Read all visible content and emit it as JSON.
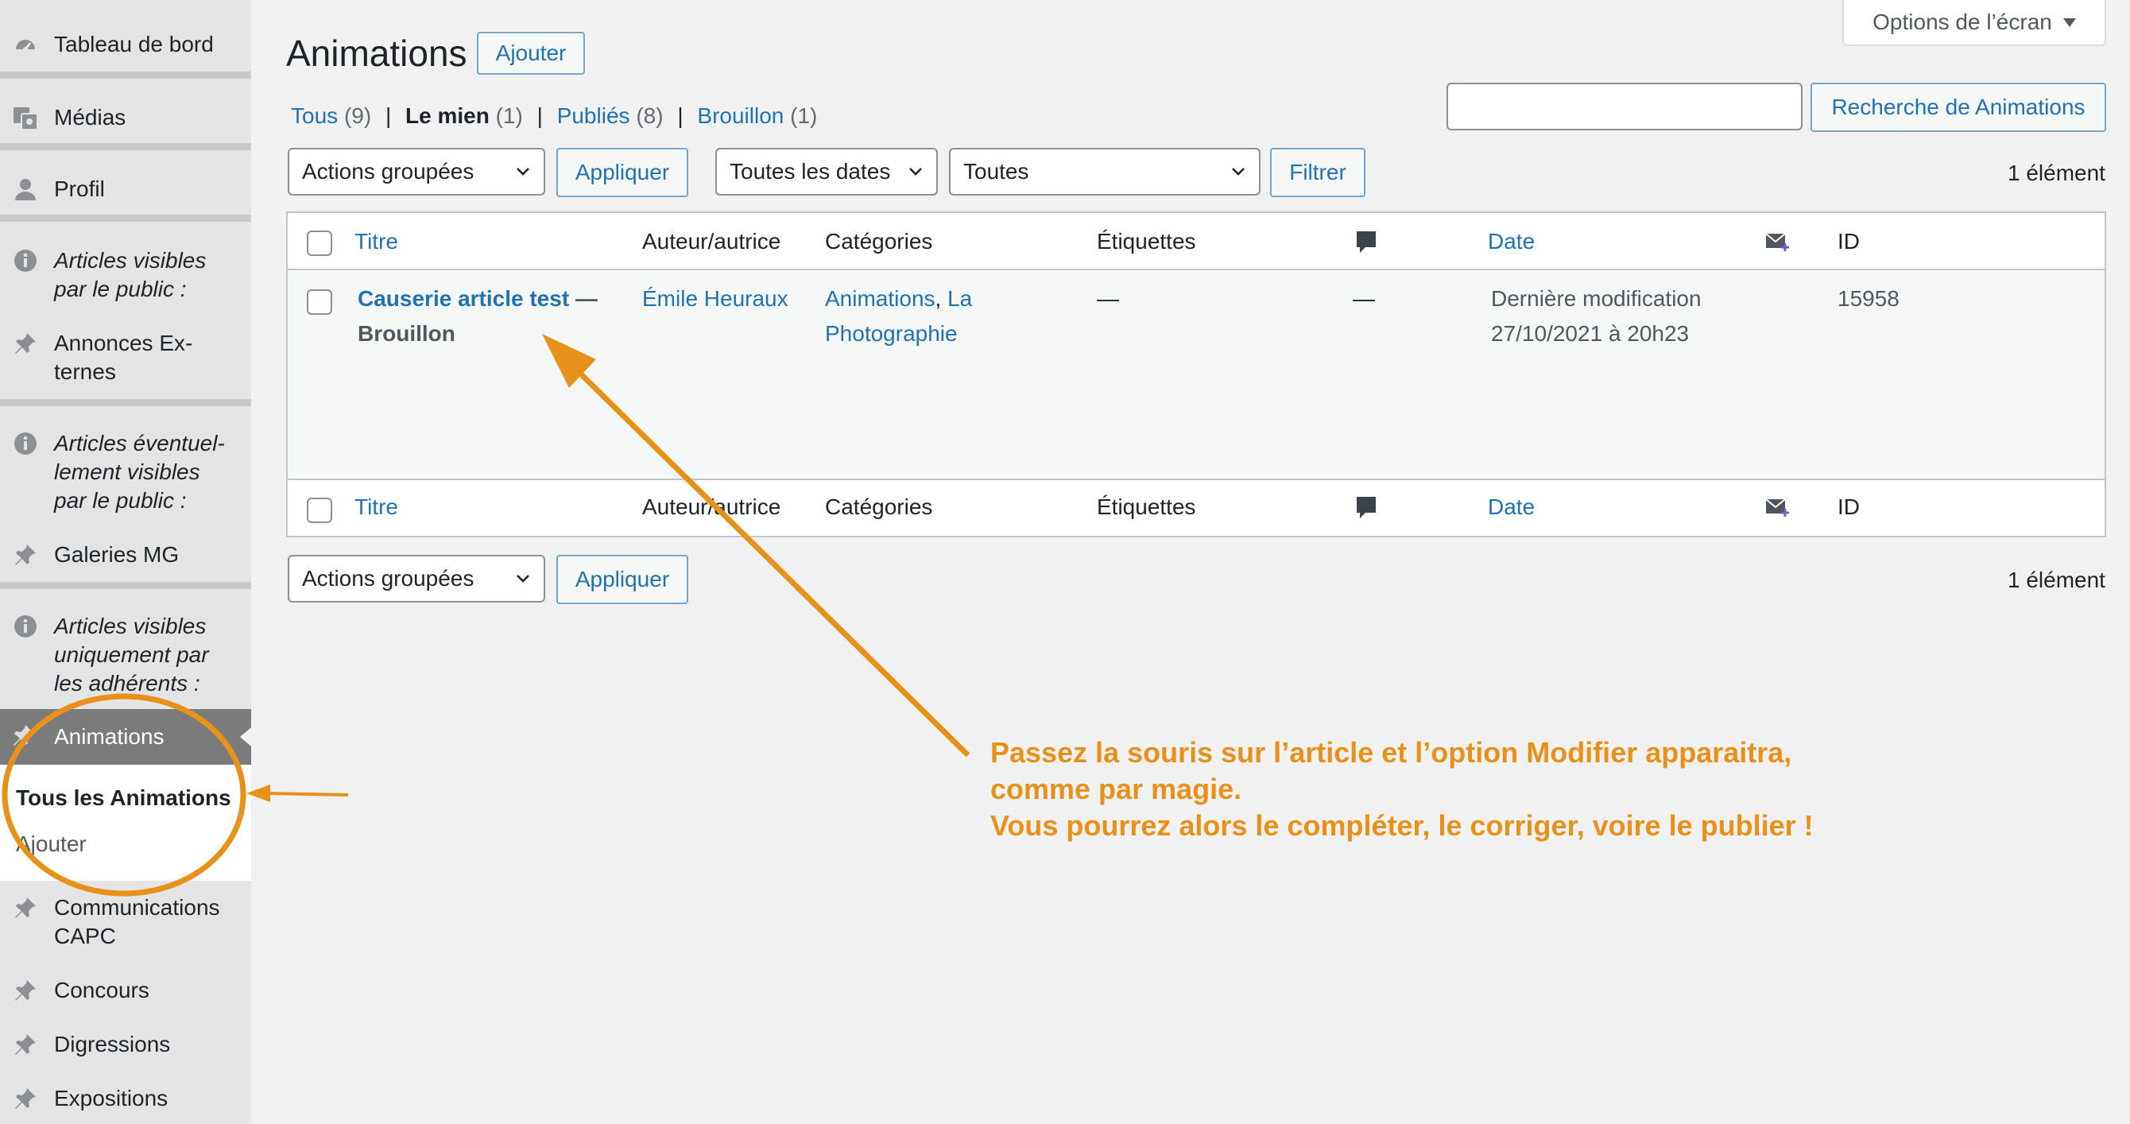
{
  "sidebar": {
    "items": [
      {
        "label": "Tableau de bord",
        "icon": "dashboard-icon"
      },
      {
        "label": "Médias",
        "icon": "media-icon"
      },
      {
        "label": "Profil",
        "icon": "user-icon"
      },
      {
        "label": "Articles visibles\npar le public :",
        "icon": "info-icon"
      },
      {
        "label": "Annonces Ex-\nternes",
        "icon": "pin-icon"
      },
      {
        "label": "Articles éventuel-\nlement visibles\npar le public :",
        "icon": "info-icon"
      },
      {
        "label": "Galeries MG",
        "icon": "pin-icon"
      },
      {
        "label": "Articles visibles\nuniquement par\nles adhérents :",
        "icon": "info-icon"
      },
      {
        "label": "Animations",
        "icon": "pin-icon"
      },
      {
        "label": "Communications\nCAPC",
        "icon": "pin-icon"
      },
      {
        "label": "Concours",
        "icon": "pin-icon"
      },
      {
        "label": "Digressions",
        "icon": "pin-icon"
      },
      {
        "label": "Expositions",
        "icon": "pin-icon"
      }
    ],
    "submenu": {
      "all": "Tous les Animations",
      "add": "Ajouter"
    }
  },
  "header": {
    "title": "Animations",
    "add_button": "Ajouter",
    "screen_options": "Options de l’écran"
  },
  "views": {
    "all": {
      "label": "Tous",
      "count": "(9)"
    },
    "mine": {
      "label": "Le mien",
      "count": "(1)"
    },
    "published": {
      "label": "Publiés",
      "count": "(8)"
    },
    "draft": {
      "label": "Brouillon",
      "count": "(1)"
    }
  },
  "search": {
    "value": "",
    "button": "Recherche de Animations"
  },
  "toolbar_top": {
    "bulk_actions": "Actions groupées",
    "apply": "Appliquer",
    "dates": "Toutes les dates",
    "categories": "Toutes",
    "filter": "Filtrer",
    "count": "1 élément"
  },
  "table": {
    "columns": {
      "title": "Titre",
      "author": "Auteur/autrice",
      "categories": "Catégories",
      "tags": "Étiquettes",
      "comments_icon": "comment-bubble-icon",
      "date": "Date",
      "mail_icon": "mail-plus-icon",
      "id": "ID"
    },
    "rows": [
      {
        "title": "Causerie article test",
        "state": " — Brouillon",
        "author": "Émile Heuraux",
        "categories": [
          "Animations",
          "La Photographie"
        ],
        "tags": "—",
        "comments": "—",
        "date_status": "Dernière modification",
        "date_value": "27/10/2021 à 20h23",
        "id": "15958"
      }
    ]
  },
  "toolbar_bottom": {
    "bulk_actions": "Actions groupées",
    "apply": "Appliquer",
    "count": "1 élément"
  },
  "annotation": {
    "text": "Passez la souris sur l’article et l’option Modifier apparaitra,\ncomme par magie.\nVous pourrez alors le compléter, le corriger, voire le publier !",
    "color": "#e8911a"
  },
  "colors": {
    "link": "#2271b1",
    "sidebar_bg": "#e4e4e4",
    "active_bg": "#7b7b7b",
    "annotation": "#e8911a"
  }
}
